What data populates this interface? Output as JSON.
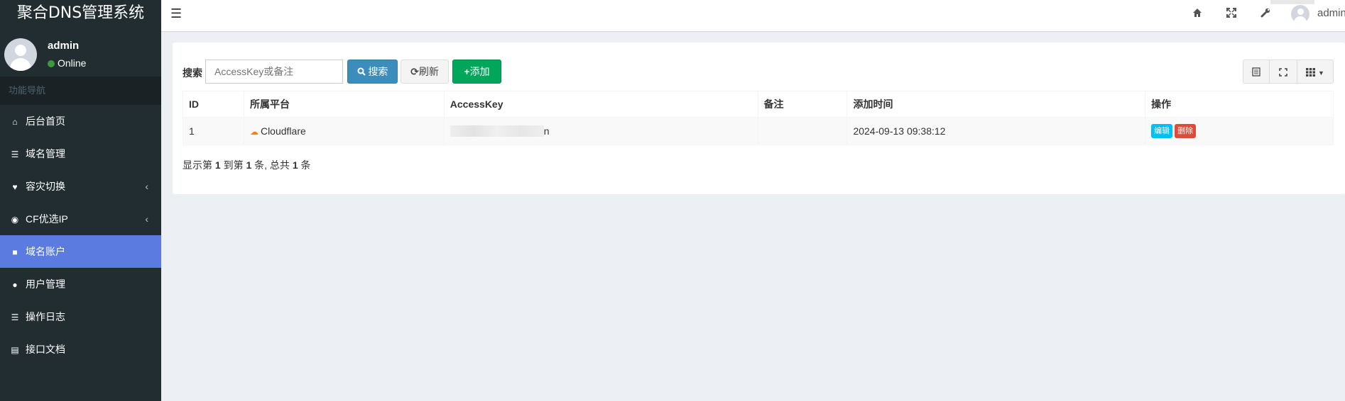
{
  "app": {
    "title": "聚合DNS管理系统"
  },
  "user": {
    "name": "admin",
    "status": "Online"
  },
  "sidebar": {
    "header": "功能导航",
    "items": [
      {
        "label": "后台首页",
        "icon": "home-icon",
        "glyph": "⌂"
      },
      {
        "label": "域名管理",
        "icon": "list-icon",
        "glyph": "☰"
      },
      {
        "label": "容灾切换",
        "icon": "heartbeat-icon",
        "glyph": "♥"
      },
      {
        "label": "CF优选IP",
        "icon": "globe-icon",
        "glyph": "◉"
      },
      {
        "label": "域名账户",
        "icon": "lock-icon",
        "glyph": "■"
      },
      {
        "label": "用户管理",
        "icon": "user-icon",
        "glyph": "●"
      },
      {
        "label": "操作日志",
        "icon": "list-icon",
        "glyph": "☰"
      },
      {
        "label": "接口文档",
        "icon": "book-icon",
        "glyph": "▤"
      }
    ],
    "active_index": 4
  },
  "header": {
    "menu_icon": "☰",
    "username": "admin",
    "icons": [
      "home-icon",
      "fullscreen-icon",
      "wrench-icon"
    ]
  },
  "toolbar": {
    "search_label": "搜索",
    "search_placeholder": "AccessKey或备注",
    "search_button": "搜索",
    "refresh_button": "刷新",
    "add_button": "添加"
  },
  "table": {
    "columns": [
      "ID",
      "所属平台",
      "AccessKey",
      "备注",
      "添加时间",
      "操作"
    ],
    "rows": [
      {
        "id": "1",
        "platform": "Cloudflare",
        "accesskey_visible": "n",
        "remark": "",
        "created": "2024-09-13 09:38:12",
        "edit_label": "编辑",
        "delete_label": "删除"
      }
    ]
  },
  "pagination": {
    "prefix": "显示第",
    "from": "1",
    "mid1": "到第",
    "to": "1",
    "mid2": "条, 总共",
    "total": "1",
    "suffix": "条"
  },
  "colors": {
    "sidebar_bg": "#222d32",
    "active_item": "#5b7be0",
    "primary": "#3c8dbc",
    "success": "#00a65a",
    "info": "#00c0ef",
    "danger": "#dd4b39"
  }
}
